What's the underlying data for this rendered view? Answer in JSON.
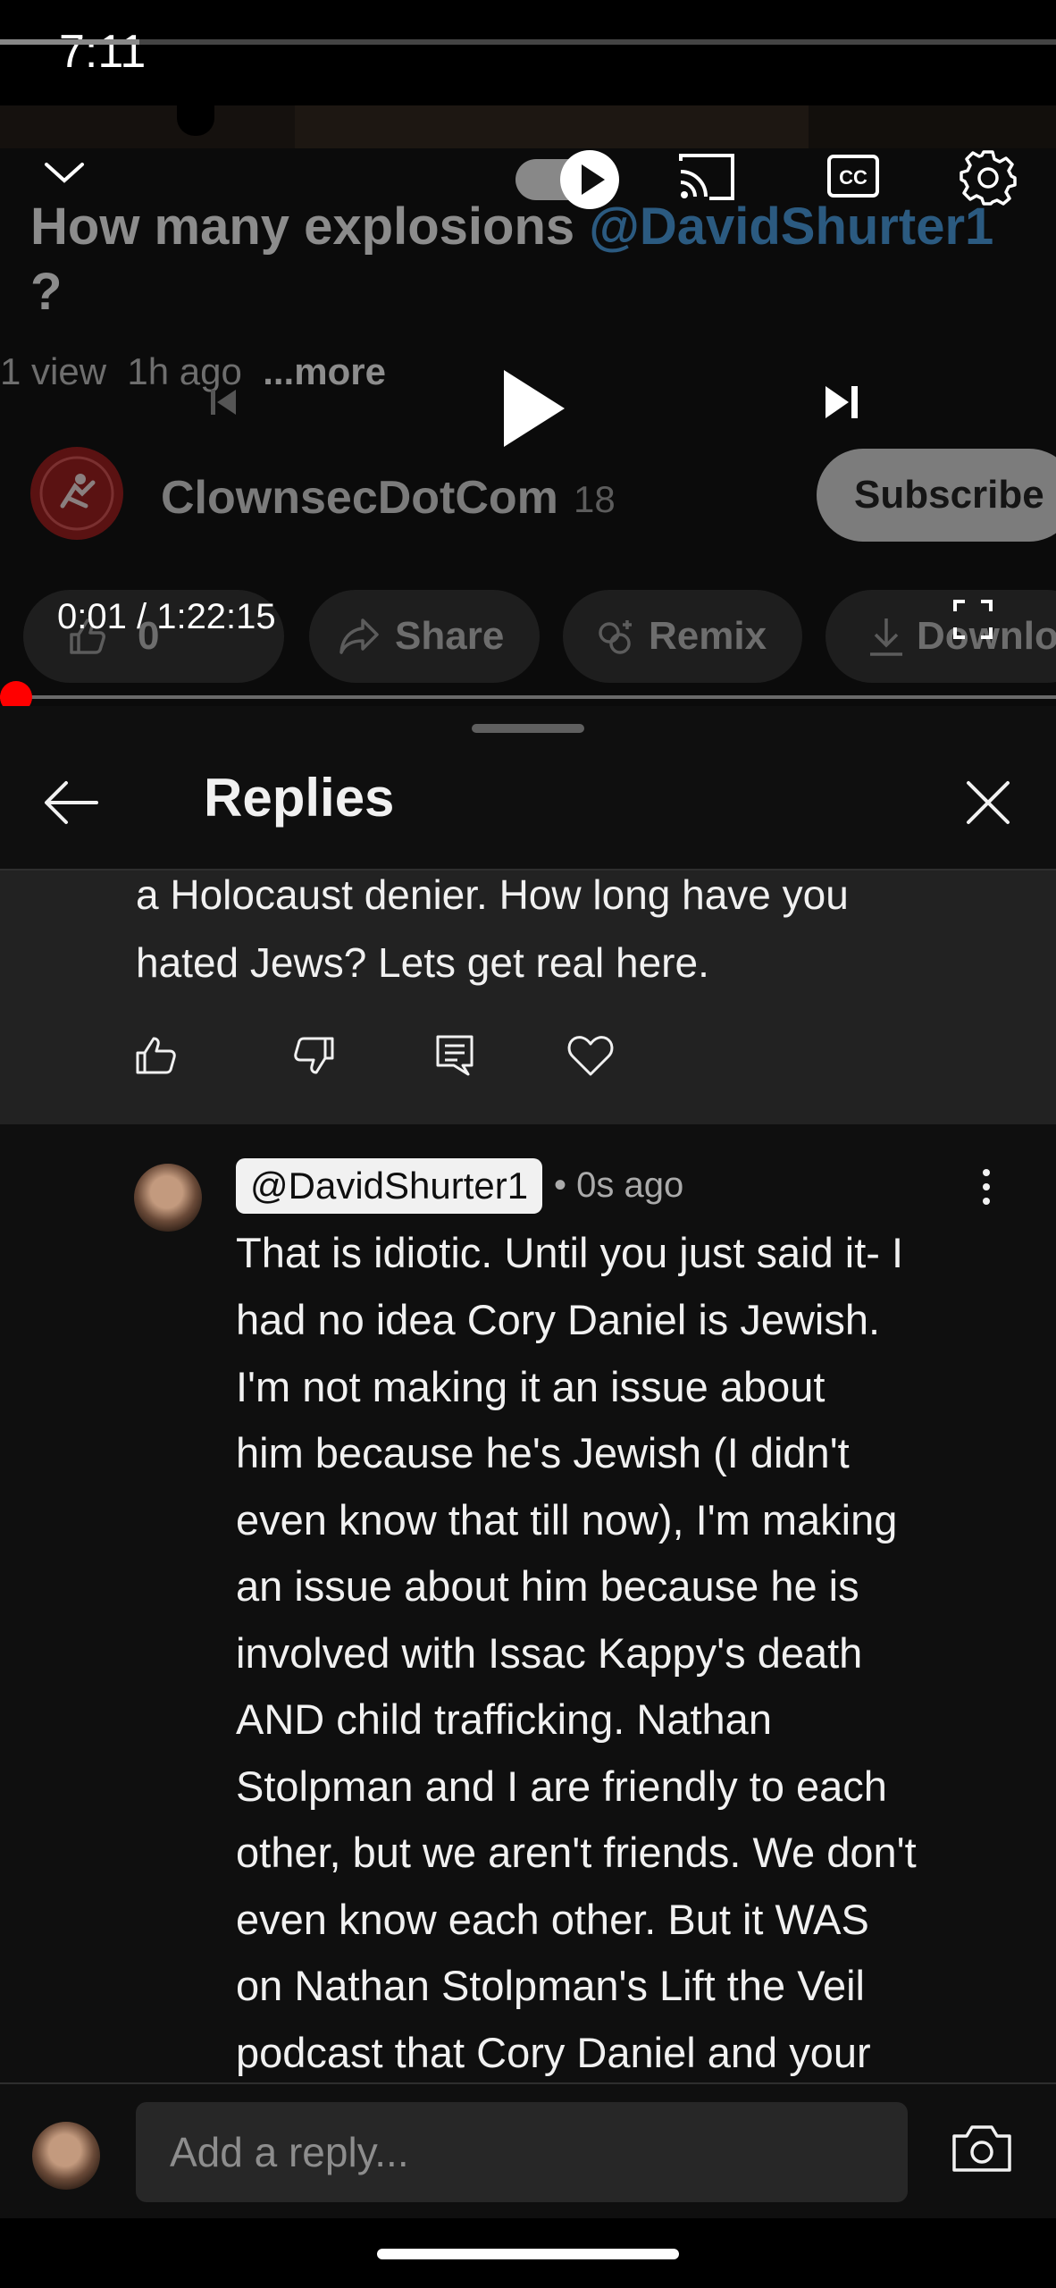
{
  "status_bar": {
    "time": "7:11"
  },
  "video": {
    "title": "How many explosions ",
    "title_mention": "@DavidShurter1",
    "title_end": "?",
    "views": "1 view",
    "age": "1h ago",
    "more": "...more",
    "channel_name": "ClownsecDotCom",
    "channel_subs": "18",
    "subscribe_label": "Subscribe",
    "like_count": "0",
    "share_label": "Share",
    "remix_label": "Remix",
    "download_label": "Downlo"
  },
  "player": {
    "current_time": "0:01",
    "separator": " / ",
    "duration": "1:22:15",
    "progress_fraction": 0.0002
  },
  "replies_panel": {
    "title": "Replies",
    "parent_comment": {
      "lines": [
        "a Holocaust denier. How long have you",
        "hated Jews? Lets get real here."
      ]
    },
    "reply": {
      "author": "@DavidShurter1",
      "time": "• 0s ago",
      "lines": [
        "That is idiotic. Until you just said it- I",
        "had no idea Cory Daniel is Jewish.",
        "I'm not making it an issue about",
        "him because he's Jewish (I didn't",
        "even know that till now), I'm making",
        "an issue about him because he is",
        "involved with Issac Kappy's death",
        "AND child trafficking. Nathan",
        "Stolpman and I are friendly to each",
        "other, but we aren't friends. We don't",
        "even know each other. But it WAS",
        "on Nathan Stolpman's Lift the Veil",
        "podcast that Cory Daniel and your"
      ]
    },
    "composer": {
      "placeholder": "Add a reply..."
    }
  },
  "colors": {
    "background": "#0f0f0f",
    "highlight": "#222222",
    "progress": "#ff0000",
    "mention": "#3ea6ff"
  }
}
